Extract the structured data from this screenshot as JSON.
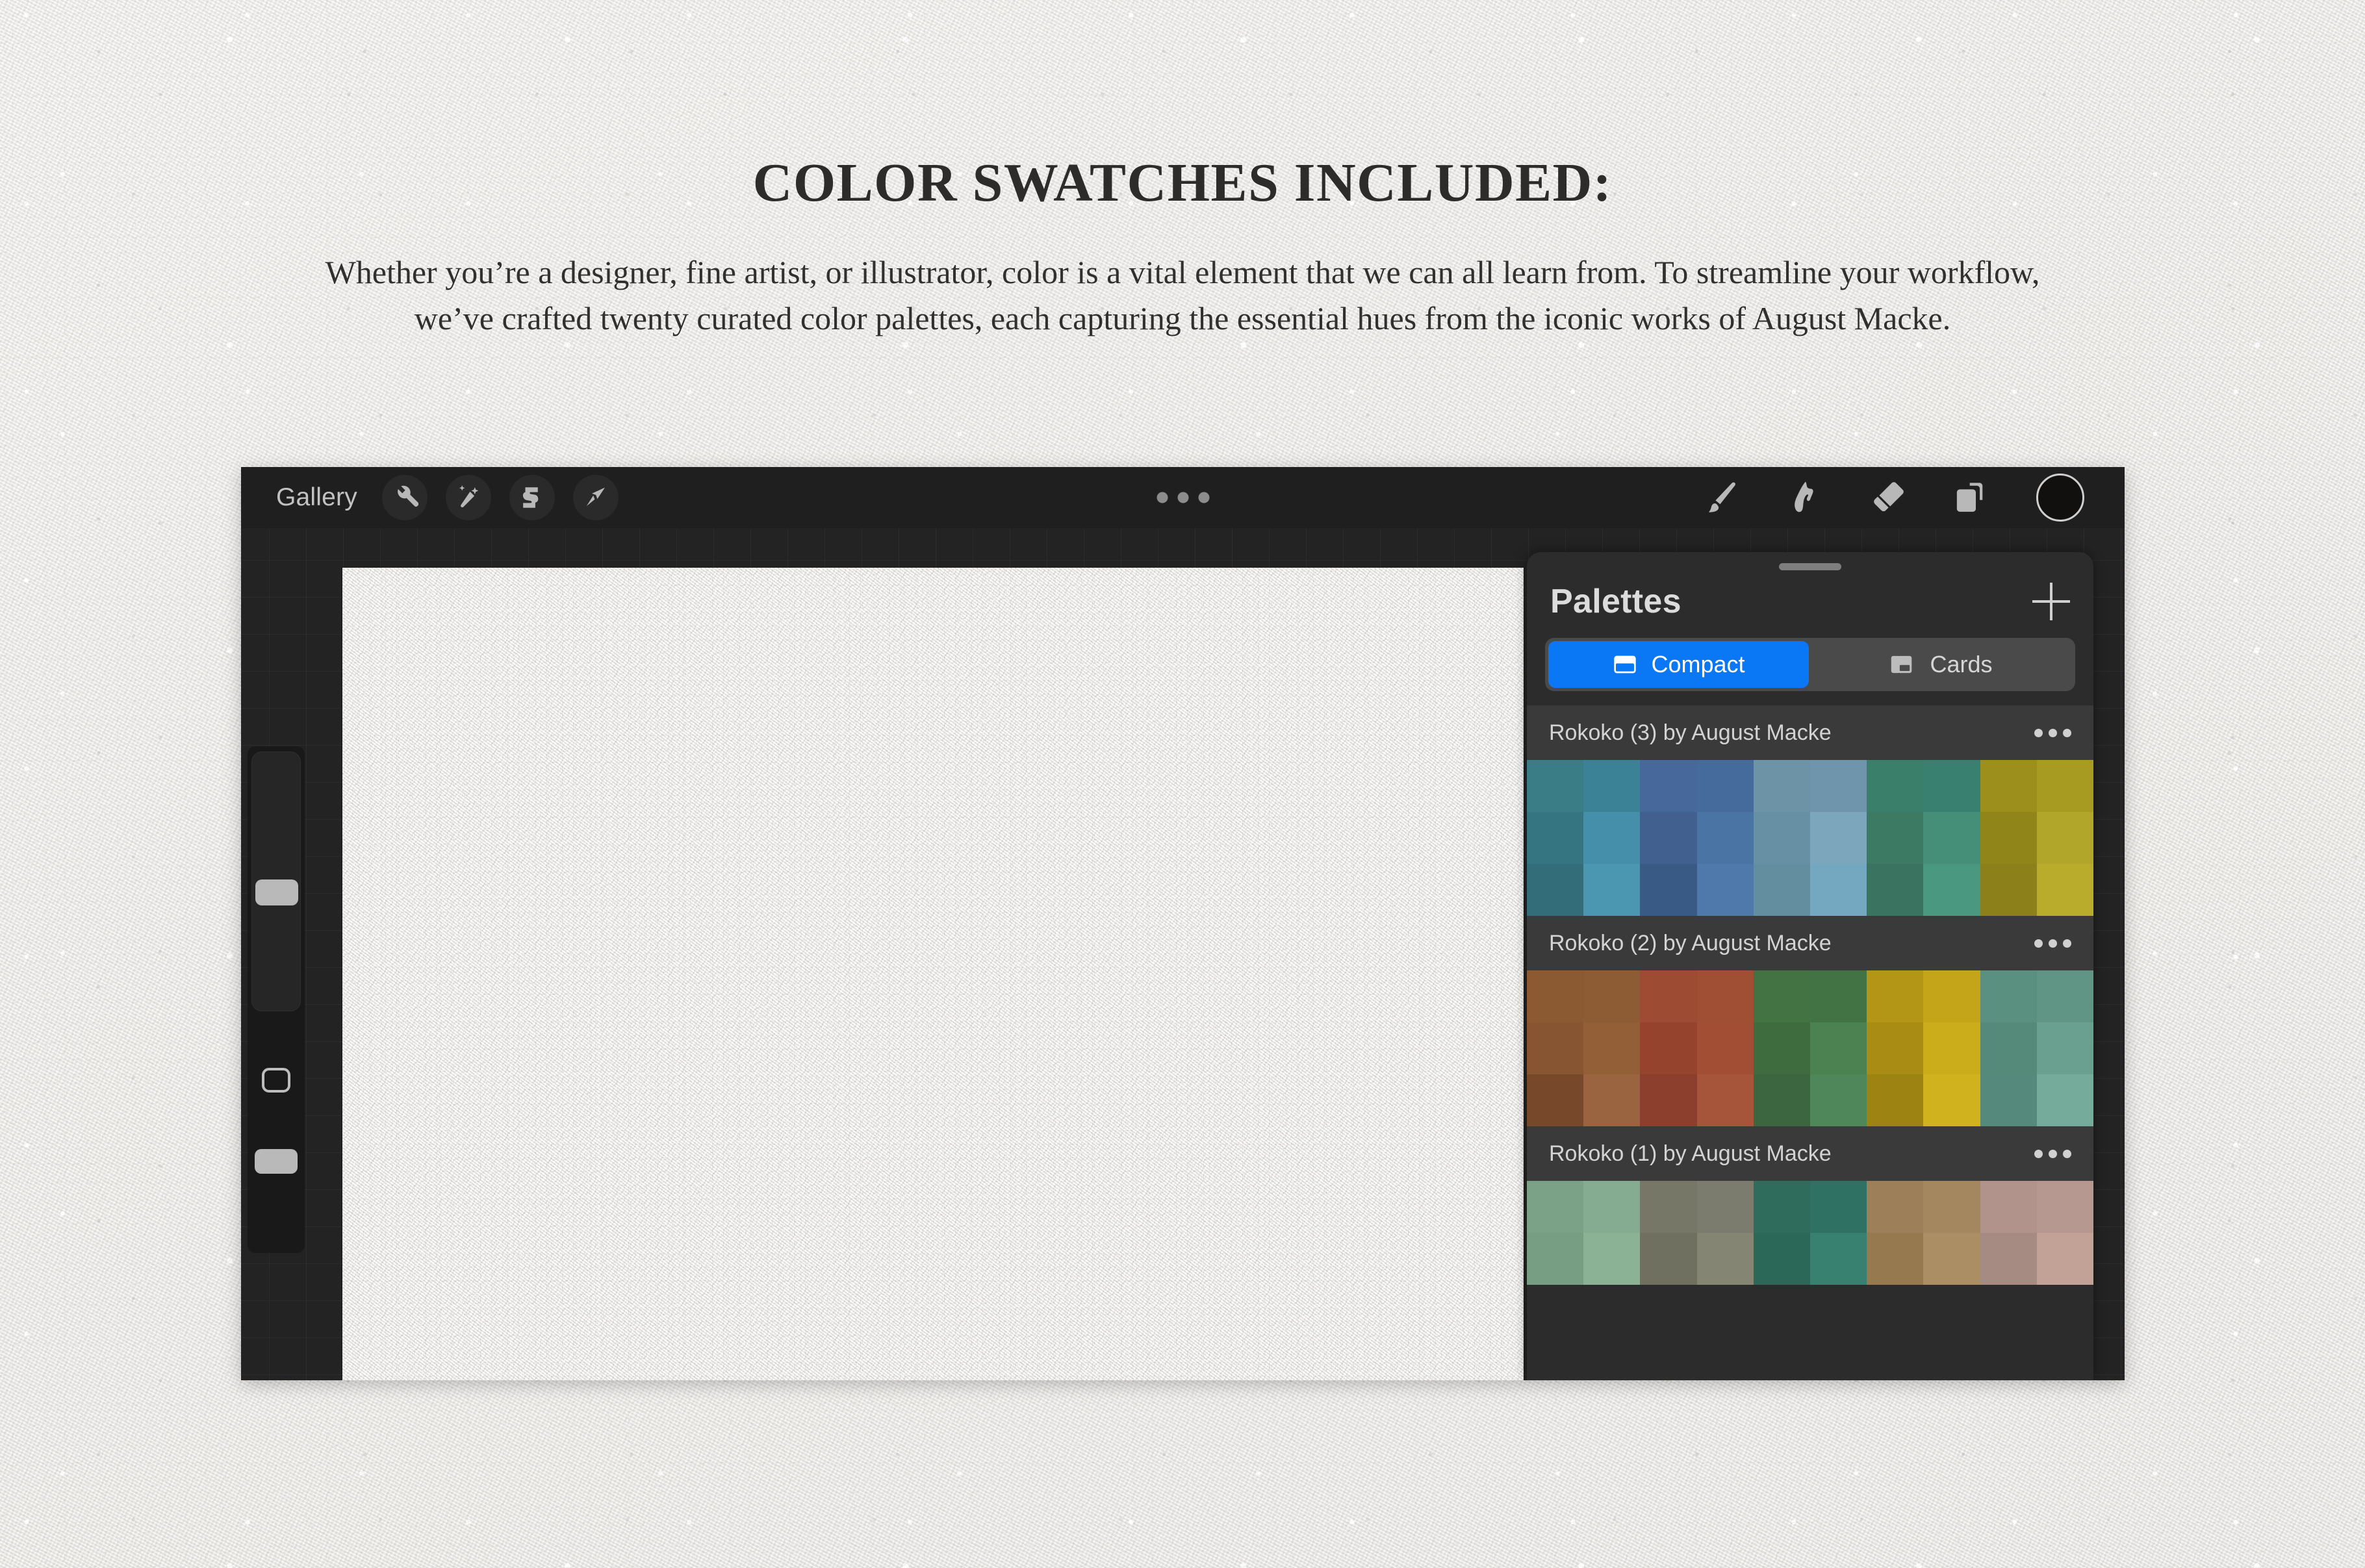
{
  "page": {
    "headline": "COLOR SWATCHES INCLUDED:",
    "body": "Whether you’re a designer, fine artist, or illustrator, color is a vital element that we can all learn from. To streamline your workflow, we’ve crafted twenty curated color palettes, each capturing the essential hues from the iconic works of August Macke."
  },
  "app": {
    "toolbar": {
      "gallery_label": "Gallery",
      "left_tools": [
        {
          "name": "actions-wrench-icon",
          "label": "Actions"
        },
        {
          "name": "adjustments-wand-icon",
          "label": "Adjustments"
        },
        {
          "name": "selection-icon",
          "label": "Selection"
        },
        {
          "name": "transform-arrow-icon",
          "label": "Transform"
        }
      ],
      "center_menu": "more-options-icon",
      "right_tools": [
        {
          "name": "paintbrush-icon",
          "label": "Paint"
        },
        {
          "name": "smudge-icon",
          "label": "Smudge"
        },
        {
          "name": "eraser-icon",
          "label": "Erase"
        },
        {
          "name": "layers-icon",
          "label": "Layers"
        }
      ],
      "color_swatch": "#1a1616"
    },
    "sidebar": {
      "brush_size_label": "Brush size",
      "modify_label": "Modify",
      "opacity_label": "Opacity"
    }
  },
  "palettes_panel": {
    "title": "Palettes",
    "add_button": "add-palette-icon",
    "view_modes": [
      {
        "label": "Compact",
        "icon": "compact-view-icon",
        "active": true
      },
      {
        "label": "Cards",
        "icon": "cards-view-icon",
        "active": false
      }
    ],
    "accent_color": "#0a78f5",
    "panel_background": "#2c2c2c",
    "palettes": [
      {
        "name": "Rokoko (3) by August Macke",
        "menu": "palette-options-icon",
        "rows": [
          [
            "#3a7d86",
            "#3c8296",
            "#46689a",
            "#456b9c",
            "#6d93a7",
            "#6e95ab",
            "#3a7f6a",
            "#3a8070",
            "#9c8f1c",
            "#a79b21"
          ],
          [
            "#357581",
            "#468faa",
            "#41608f",
            "#4a74a4",
            "#6790a4",
            "#7ba6bc",
            "#3c7a64",
            "#458f78",
            "#8f8519",
            "#b2a62a"
          ],
          [
            "#326d79",
            "#4b96b0",
            "#3a5a86",
            "#4f79ab",
            "#628ea0",
            "#74a8c0",
            "#3a7461",
            "#4b9881",
            "#8b8019",
            "#b9ac2d"
          ]
        ]
      },
      {
        "name": "Rokoko (2) by August Macke",
        "menu": "palette-options-icon",
        "rows": [
          [
            "#8b5a32",
            "#8e5c34",
            "#9d4b33",
            "#a04f35",
            "#437243",
            "#417344",
            "#b39615",
            "#c4a519",
            "#5a907f",
            "#609585"
          ],
          [
            "#875531",
            "#935f37",
            "#95432d",
            "#a14e35",
            "#3e6c3e",
            "#4c8251",
            "#a98c13",
            "#cbad1c",
            "#55897a",
            "#69a08f"
          ],
          [
            "#77482a",
            "#9a6440",
            "#8c3f2c",
            "#a7553a",
            "#3b6640",
            "#50875a",
            "#9d8311",
            "#d0b21e",
            "#54897c",
            "#74ab9a"
          ]
        ]
      },
      {
        "name": "Rokoko (1) by August Macke",
        "menu": "palette-options-icon",
        "rows": [
          [
            "#7ba187",
            "#85ac90",
            "#767766",
            "#7b7c6d",
            "#2f6c5c",
            "#2f7263",
            "#9d8059",
            "#a4875f",
            "#b1938b",
            "#b79890"
          ],
          [
            "#779e83",
            "#8bb295",
            "#6f7060",
            "#848573",
            "#2c6857",
            "#38806f",
            "#96794f",
            "#ab8e63",
            "#a68b82",
            "#c2a196"
          ]
        ]
      }
    ]
  }
}
